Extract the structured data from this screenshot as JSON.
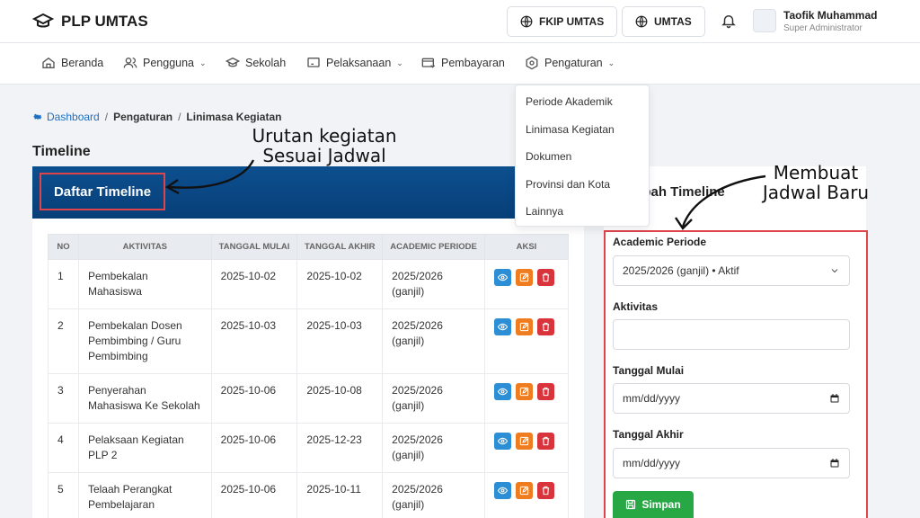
{
  "app": {
    "title": "PLP UMTAS"
  },
  "topbar": {
    "btn1": "FKIP UMTAS",
    "btn2": "UMTAS",
    "user_name": "Taofik Muhammad",
    "user_role": "Super Administrator"
  },
  "nav": {
    "items": [
      {
        "label": "Beranda",
        "icon": "home-icon"
      },
      {
        "label": "Pengguna",
        "icon": "users-icon"
      },
      {
        "label": "Sekolah",
        "icon": "school-icon"
      },
      {
        "label": "Pelaksanaan",
        "icon": "monitor-icon"
      },
      {
        "label": "Pembayaran",
        "icon": "payment-icon"
      },
      {
        "label": "Pengaturan",
        "icon": "settings-icon"
      }
    ]
  },
  "dropdown": {
    "items": [
      "Periode Akademik",
      "Linimasa Kegiatan",
      "Dokumen",
      "Provinsi dan Kota",
      "Lainnya"
    ]
  },
  "breadcrumb": {
    "home": "Dashboard",
    "sep": "/",
    "mid": "Pengaturan",
    "current": "Linimasa Kegiatan"
  },
  "page": {
    "title": "Timeline"
  },
  "timeline": {
    "title": "Daftar Timeline",
    "headers": [
      "NO",
      "AKTIVITAS",
      "TANGGAL MULAI",
      "TANGGAL AKHIR",
      "ACADEMIC PERIODE",
      "AKSI"
    ],
    "rows": [
      {
        "no": "1",
        "activity": "Pembekalan Mahasiswa",
        "start": "2025-10-02",
        "end": "2025-10-02",
        "period": "2025/2026 (ganjil)"
      },
      {
        "no": "2",
        "activity": "Pembekalan Dosen Pembimbing / Guru Pembimbing",
        "start": "2025-10-03",
        "end": "2025-10-03",
        "period": "2025/2026 (ganjil)"
      },
      {
        "no": "3",
        "activity": "Penyerahan Mahasiswa Ke Sekolah",
        "start": "2025-10-06",
        "end": "2025-10-08",
        "period": "2025/2026 (ganjil)"
      },
      {
        "no": "4",
        "activity": "Pelaksaan Kegiatan PLP 2",
        "start": "2025-10-06",
        "end": "2025-12-23",
        "period": "2025/2026 (ganjil)"
      },
      {
        "no": "5",
        "activity": "Telaah Perangkat Pembelajaran",
        "start": "2025-10-06",
        "end": "2025-10-11",
        "period": "2025/2026 (ganjil)"
      }
    ]
  },
  "form": {
    "title": "mbah Timeline",
    "period_label": "Academic Periode",
    "period_value": "2025/2026 (ganjil) • Aktif",
    "activity_label": "Aktivitas",
    "activity_value": "",
    "start_label": "Tanggal Mulai",
    "start_placeholder": "mm/dd/yyyy",
    "end_label": "Tanggal Akhir",
    "end_placeholder": "mm/dd/yyyy",
    "save_label": "Simpan"
  },
  "annotations": {
    "left_line1": "Urutan kegiatan",
    "left_line2": "Sesuai Jadwal",
    "right_line1": "Membuat",
    "right_line2": "Jadwal Baru"
  },
  "colors": {
    "header_blue": "#0b4a88",
    "save_green": "#28a745",
    "annotation_red": "#e0444b"
  }
}
